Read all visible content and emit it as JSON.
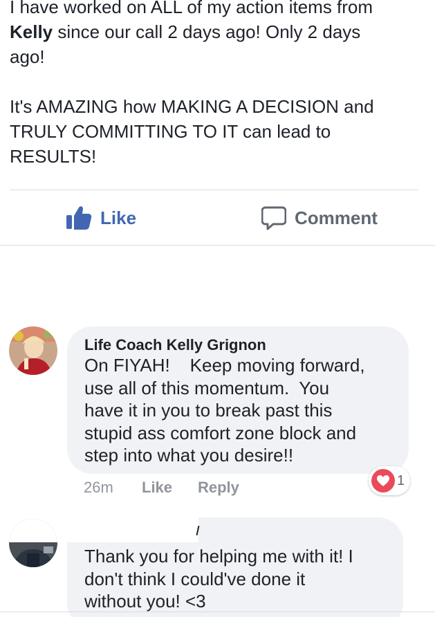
{
  "post": {
    "line1": "I have worked on ALL of my action items from",
    "author_mention": "Kelly",
    "line2_rest": " since our call 2 days ago! Only 2 days",
    "line3": "ago!",
    "para2_line1": "It's AMAZING how MAKING A DECISION and",
    "para2_line2": "TRULY COMMITTING TO IT can lead to",
    "para2_line3": "RESULTS!"
  },
  "actions": {
    "like_label": "Like",
    "comment_label": "Comment"
  },
  "comments": [
    {
      "author": "Life Coach Kelly Grignon",
      "lines": [
        "On FIYAH!    Keep moving forward,",
        "use all of this momentum.  You",
        "have it in you to break past this",
        "stupid ass comfort zone block and",
        "step into what you desire!!"
      ],
      "time": "26m",
      "like_label": "Like",
      "reply_label": "Reply",
      "reaction_count": "1"
    },
    {
      "author": "",
      "lines": [
        "Thank you for helping me with it! I",
        "don't think I could've done it",
        "without you! <3"
      ]
    }
  ],
  "colors": {
    "link_blue": "#4267b2",
    "bubble_bg": "#f0f2f5",
    "meta_gray": "#90949c",
    "heart_red": "#e94b5a"
  },
  "icons": {
    "like": "thumbs-up-icon",
    "comment": "speech-bubble-icon",
    "reaction": "heart-icon"
  }
}
